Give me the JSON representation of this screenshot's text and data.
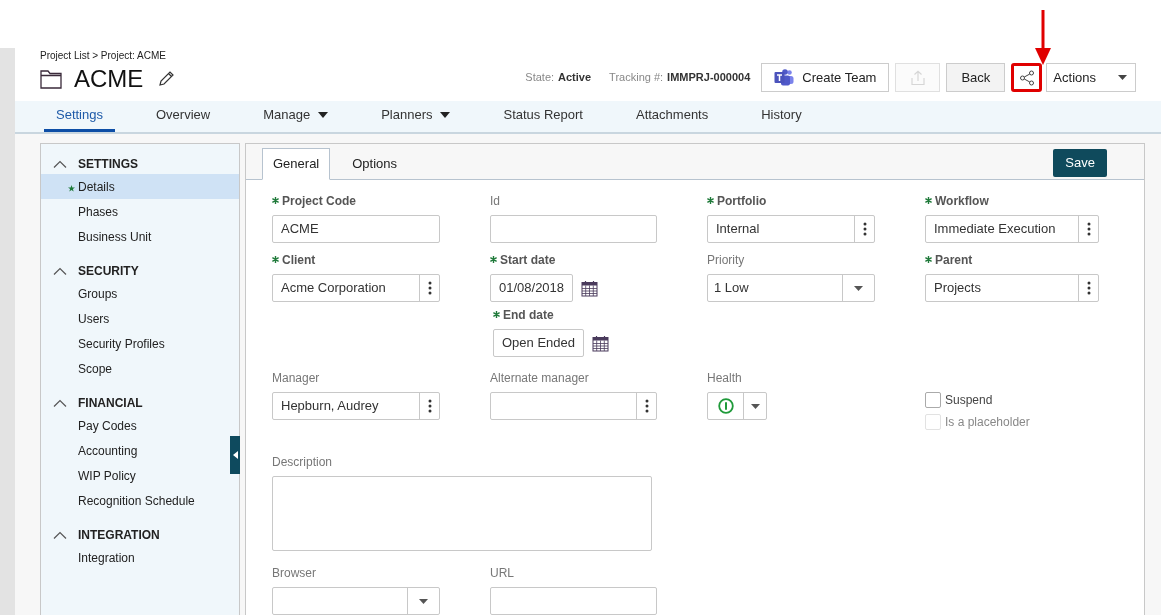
{
  "breadcrumb": "Project List > Project: ACME",
  "title": "ACME",
  "state": {
    "label": "State:",
    "value": "Active"
  },
  "tracking": {
    "label": "Tracking #:",
    "value": "IMMPRJ-000004"
  },
  "toolbar": [
    {
      "kind": "teams",
      "label": "Create Team",
      "disabled": false,
      "highlighted": false
    },
    {
      "kind": "upload",
      "disabled": true,
      "highlighted": false
    },
    {
      "kind": "text",
      "label": "Back",
      "disabled": false,
      "highlighted": false
    },
    {
      "kind": "share",
      "disabled": false,
      "highlighted": true
    },
    {
      "kind": "menu",
      "label": "Actions",
      "disabled": false,
      "highlighted": false
    }
  ],
  "nav_tabs": [
    {
      "label": "Settings",
      "selected": true,
      "has_menu": false
    },
    {
      "label": "Overview",
      "selected": false,
      "has_menu": false
    },
    {
      "label": "Manage",
      "selected": false,
      "has_menu": true
    },
    {
      "label": "Planners",
      "selected": false,
      "has_menu": true
    },
    {
      "label": "Status Report",
      "selected": false,
      "has_menu": false
    },
    {
      "label": "Attachments",
      "selected": false,
      "has_menu": false
    },
    {
      "label": "History",
      "selected": false,
      "has_menu": false
    }
  ],
  "sidebar": [
    {
      "label": "SETTINGS",
      "expanded": true,
      "items": [
        {
          "label": "Details",
          "selected": true,
          "starred": true
        },
        {
          "label": "Phases",
          "selected": false,
          "starred": false
        },
        {
          "label": "Business Unit",
          "selected": false,
          "starred": false
        }
      ]
    },
    {
      "label": "SECURITY",
      "expanded": true,
      "items": [
        {
          "label": "Groups",
          "selected": false,
          "starred": false
        },
        {
          "label": "Users",
          "selected": false,
          "starred": false
        },
        {
          "label": "Security Profiles",
          "selected": false,
          "starred": false
        },
        {
          "label": "Scope",
          "selected": false,
          "starred": false
        }
      ]
    },
    {
      "label": "FINANCIAL",
      "expanded": true,
      "items": [
        {
          "label": "Pay Codes",
          "selected": false,
          "starred": false
        },
        {
          "label": "Accounting",
          "selected": false,
          "starred": false
        },
        {
          "label": "WIP Policy",
          "selected": false,
          "starred": false
        },
        {
          "label": "Recognition Schedule",
          "selected": false,
          "starred": false
        }
      ]
    },
    {
      "label": "INTEGRATION",
      "expanded": true,
      "items": [
        {
          "label": "Integration",
          "selected": false,
          "starred": false
        }
      ]
    }
  ],
  "form_tabs": [
    {
      "label": "General",
      "selected": true
    },
    {
      "label": "Options",
      "selected": false
    }
  ],
  "save_button": "Save",
  "form": {
    "project_code": {
      "label": "Project Code",
      "required": true,
      "kind": "text",
      "value": "ACME"
    },
    "id": {
      "label": "Id",
      "required": false,
      "kind": "text"
    },
    "portfolio": {
      "label": "Portfolio",
      "required": true,
      "kind": "lookup",
      "value": "Internal"
    },
    "workflow": {
      "label": "Workflow",
      "required": true,
      "kind": "lookup",
      "value": "Immediate Execution"
    },
    "client": {
      "label": "Client",
      "required": true,
      "kind": "lookup",
      "value": "Acme Corporation"
    },
    "start_date": {
      "label": "Start date",
      "required": true,
      "kind": "date",
      "value": "01/08/2018"
    },
    "priority": {
      "label": "Priority",
      "required": false,
      "kind": "dropdown",
      "value": "1 Low"
    },
    "parent": {
      "label": "Parent",
      "required": true,
      "kind": "lookup",
      "value": "Projects"
    },
    "end_date": {
      "label": "End date",
      "required": true,
      "kind": "date",
      "value": "Open Ended"
    },
    "manager": {
      "label": "Manager",
      "required": false,
      "kind": "lookup",
      "value": "Hepburn, Audrey"
    },
    "alternate_manager": {
      "label": "Alternate manager",
      "required": false,
      "kind": "lookup"
    },
    "health": {
      "label": "Health",
      "required": false,
      "kind": "health"
    },
    "checkboxes": [
      {
        "label": "Suspend",
        "checked": false,
        "disabled": false
      },
      {
        "label": "Is a placeholder",
        "checked": false,
        "disabled": true
      }
    ],
    "description": {
      "label": "Description",
      "required": false,
      "kind": "textarea"
    },
    "browser": {
      "label": "Browser",
      "required": false,
      "kind": "dropdown"
    },
    "url": {
      "label": "URL",
      "required": false,
      "kind": "text"
    }
  }
}
